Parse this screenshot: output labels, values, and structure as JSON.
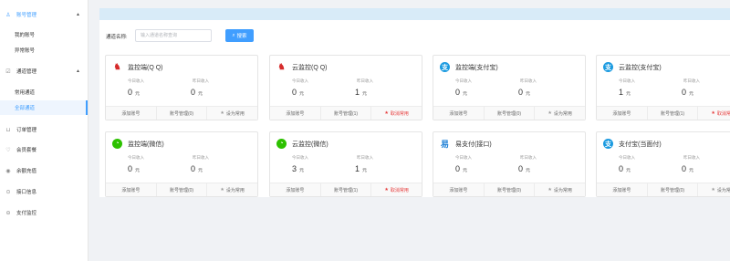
{
  "sidebar": {
    "groups": [
      {
        "label": "账号管理",
        "icon": "user-icon",
        "caret": "▲"
      },
      {
        "label": "通道管理",
        "icon": "channel-icon",
        "caret": "▲"
      },
      {
        "label": "订单管理",
        "icon": "cart-icon"
      },
      {
        "label": "会员套餐",
        "icon": "vip-icon"
      },
      {
        "label": "余额充值",
        "icon": "recharge-icon"
      },
      {
        "label": "接口信息",
        "icon": "api-icon"
      },
      {
        "label": "支付监控",
        "icon": "monitor-icon"
      }
    ],
    "account_subs": [
      "我的账号",
      "异常账号"
    ],
    "channel_subs": [
      "常用通道",
      "全部通道"
    ]
  },
  "search": {
    "label": "通道名称:",
    "placeholder": "输入通道名称查询",
    "button_label": "搜索"
  },
  "cards": [
    {
      "name": "监控端(Q Q)",
      "icon": "qq-icon",
      "today_label": "今日收入",
      "yesterday_label": "昨日收入",
      "today": "0",
      "yesterday": "0",
      "unit": "元",
      "add": "添加账号",
      "manage": "账号管理(0)",
      "fav": "设为常用",
      "is_fav": false
    },
    {
      "name": "云监控(Q Q)",
      "icon": "qq-icon",
      "today_label": "今日收入",
      "yesterday_label": "昨日收入",
      "today": "0",
      "yesterday": "1",
      "unit": "元",
      "add": "添加账号",
      "manage": "账号管理(1)",
      "fav": "取消常用",
      "is_fav": true
    },
    {
      "name": "监控端(支付宝)",
      "icon": "alipay-icon",
      "today_label": "今日收入",
      "yesterday_label": "昨日收入",
      "today": "0",
      "yesterday": "0",
      "unit": "元",
      "add": "添加账号",
      "manage": "账号管理(0)",
      "fav": "设为常用",
      "is_fav": false
    },
    {
      "name": "云监控(支付宝)",
      "icon": "alipay-icon",
      "today_label": "今日收入",
      "yesterday_label": "昨日收入",
      "today": "1",
      "yesterday": "0",
      "unit": "元",
      "add": "添加账号",
      "manage": "账号管理(1)",
      "fav": "取消常用",
      "is_fav": true
    },
    {
      "name": "监控端(微信)",
      "icon": "wechat-icon",
      "today_label": "今日收入",
      "yesterday_label": "昨日收入",
      "today": "0",
      "yesterday": "0",
      "unit": "元",
      "add": "添加账号",
      "manage": "账号管理(0)",
      "fav": "设为常用",
      "is_fav": false
    },
    {
      "name": "云监控(微信)",
      "icon": "wechat-icon",
      "today_label": "今日收入",
      "yesterday_label": "昨日收入",
      "today": "3",
      "yesterday": "1",
      "unit": "元",
      "add": "添加账号",
      "manage": "账号管理(1)",
      "fav": "取消常用",
      "is_fav": true
    },
    {
      "name": "易支付(接口)",
      "icon": "easypay-icon",
      "today_label": "今日收入",
      "yesterday_label": "昨日收入",
      "today": "0",
      "yesterday": "0",
      "unit": "元",
      "add": "添加账号",
      "manage": "账号管理(0)",
      "fav": "设为常用",
      "is_fav": false
    },
    {
      "name": "支付宝(当面付)",
      "icon": "alipay-icon",
      "today_label": "今日收入",
      "yesterday_label": "昨日收入",
      "today": "0",
      "yesterday": "0",
      "unit": "元",
      "add": "添加账号",
      "manage": "账号管理(0)",
      "fav": "设为常用",
      "is_fav": false
    }
  ],
  "colors": {
    "accent": "#409eff",
    "fav": "#e63b3b",
    "topbar": "#d8ebf8"
  }
}
